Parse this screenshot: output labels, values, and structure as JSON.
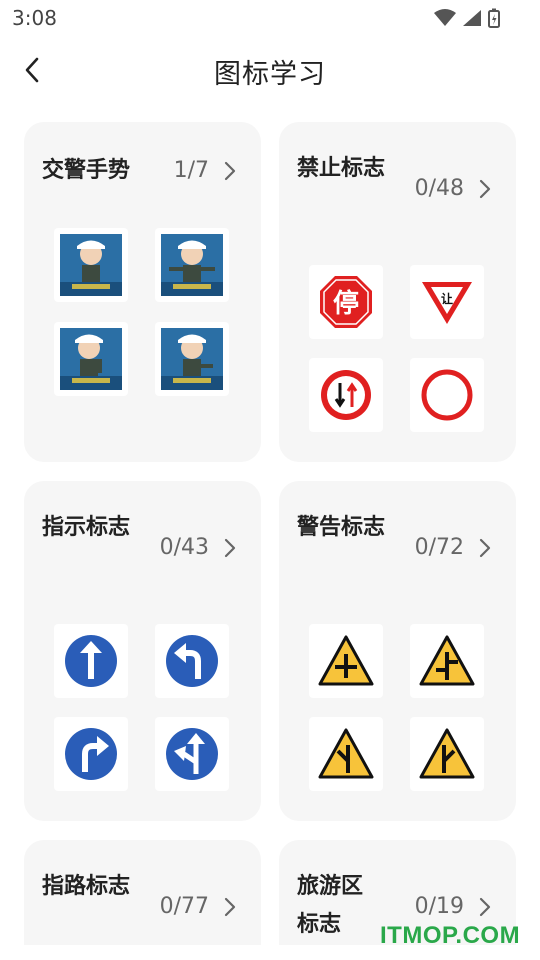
{
  "status_bar": {
    "time": "3:08",
    "icons": [
      "wifi-icon",
      "signal-icon",
      "battery-icon"
    ]
  },
  "header": {
    "back_icon": "chevron-left-icon",
    "title": "图标学习"
  },
  "categories": [
    {
      "title": "交警手势",
      "count": "1/7",
      "icons": [
        "police-stop-icon",
        "police-go-straight-icon",
        "police-left-turn-icon",
        "police-turn-icon"
      ]
    },
    {
      "title": "禁止标志",
      "count": "0/48",
      "icons": [
        "stop-sign-icon",
        "yield-sign-icon",
        "priority-oncoming-icon",
        "no-vehicles-icon"
      ],
      "sign_texts": [
        "停",
        "让"
      ]
    },
    {
      "title": "指示标志",
      "count": "0/43",
      "icons": [
        "straight-arrow-icon",
        "left-turn-arrow-icon",
        "right-turn-arrow-icon",
        "straight-left-arrow-icon"
      ]
    },
    {
      "title": "警告标志",
      "count": "0/72",
      "icons": [
        "crossroad-warning-icon",
        "crossroad-offset-warning-icon",
        "merge-left-warning-icon",
        "merge-right-warning-icon"
      ]
    },
    {
      "title": "指路标志",
      "count": "0/77",
      "icons": []
    },
    {
      "title": "旅游区标志",
      "count": "0/19",
      "icons": []
    }
  ],
  "colors": {
    "card_bg": "#f6f6f6",
    "sign_red": "#e02020",
    "sign_blue": "#2a5db8",
    "warning_yellow": "#f7c33a",
    "watermark_green": "#2aa84a"
  },
  "watermark": "ITMOP.COM"
}
